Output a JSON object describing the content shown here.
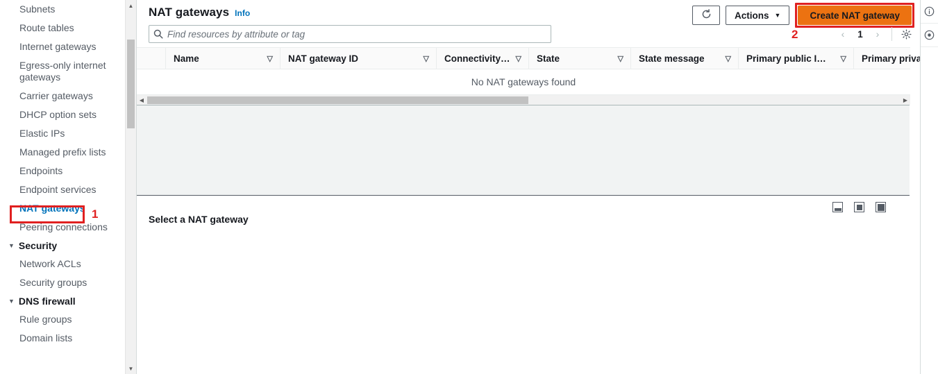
{
  "sidebar": {
    "items": [
      {
        "label": "Subnets",
        "type": "link",
        "active": false
      },
      {
        "label": "Route tables",
        "type": "link",
        "active": false
      },
      {
        "label": "Internet gateways",
        "type": "link",
        "active": false
      },
      {
        "label": "Egress-only internet gateways",
        "type": "link",
        "active": false
      },
      {
        "label": "Carrier gateways",
        "type": "link",
        "active": false
      },
      {
        "label": "DHCP option sets",
        "type": "link",
        "active": false
      },
      {
        "label": "Elastic IPs",
        "type": "link",
        "active": false
      },
      {
        "label": "Managed prefix lists",
        "type": "link",
        "active": false
      },
      {
        "label": "Endpoints",
        "type": "link",
        "active": false
      },
      {
        "label": "Endpoint services",
        "type": "link",
        "active": false
      },
      {
        "label": "NAT gateways",
        "type": "link",
        "active": true
      },
      {
        "label": "Peering connections",
        "type": "link",
        "active": false
      },
      {
        "label": "Security",
        "type": "section"
      },
      {
        "label": "Network ACLs",
        "type": "link",
        "active": false
      },
      {
        "label": "Security groups",
        "type": "link",
        "active": false
      },
      {
        "label": "DNS firewall",
        "type": "section"
      },
      {
        "label": "Rule groups",
        "type": "link",
        "active": false
      },
      {
        "label": "Domain lists",
        "type": "link",
        "active": false
      }
    ]
  },
  "header": {
    "title": "NAT gateways",
    "info_label": "Info"
  },
  "search": {
    "placeholder": "Find resources by attribute or tag",
    "value": "",
    "icon": "search-icon"
  },
  "toolbar": {
    "refresh_icon": "refresh-icon",
    "actions_label": "Actions",
    "actions_caret": "▼",
    "create_label": "Create NAT gateway",
    "create_color": "#ec7211"
  },
  "pagination": {
    "prev": "‹",
    "page": "1",
    "next": "›",
    "settings_icon": "gear-icon"
  },
  "table": {
    "columns": [
      {
        "label": "",
        "name": "select-all"
      },
      {
        "label": "Name",
        "name": "name"
      },
      {
        "label": "NAT gateway ID",
        "name": "nat-gateway-id"
      },
      {
        "label": "Connectivity…",
        "name": "connectivity"
      },
      {
        "label": "State",
        "name": "state"
      },
      {
        "label": "State message",
        "name": "state-message"
      },
      {
        "label": "Primary public I…",
        "name": "primary-public-ip"
      },
      {
        "label": "Primary priva",
        "name": "primary-private-ip"
      }
    ],
    "sort_glyph": "▽",
    "rows": [],
    "empty_text": "No NAT gateways found"
  },
  "split_panel": {
    "title": "Select a NAT gateway",
    "layout_options": [
      {
        "name": "split-panel-bottom-icon"
      },
      {
        "name": "split-panel-side-icon"
      },
      {
        "name": "split-panel-full-icon"
      }
    ]
  },
  "right_rail": {
    "items": [
      {
        "name": "info-panel-icon",
        "glyph": "ⓘ"
      },
      {
        "name": "help-panel-icon",
        "glyph": "⊙"
      }
    ]
  },
  "annotations": {
    "step1": "1",
    "step2": "2",
    "highlight_color": "#e02020"
  }
}
